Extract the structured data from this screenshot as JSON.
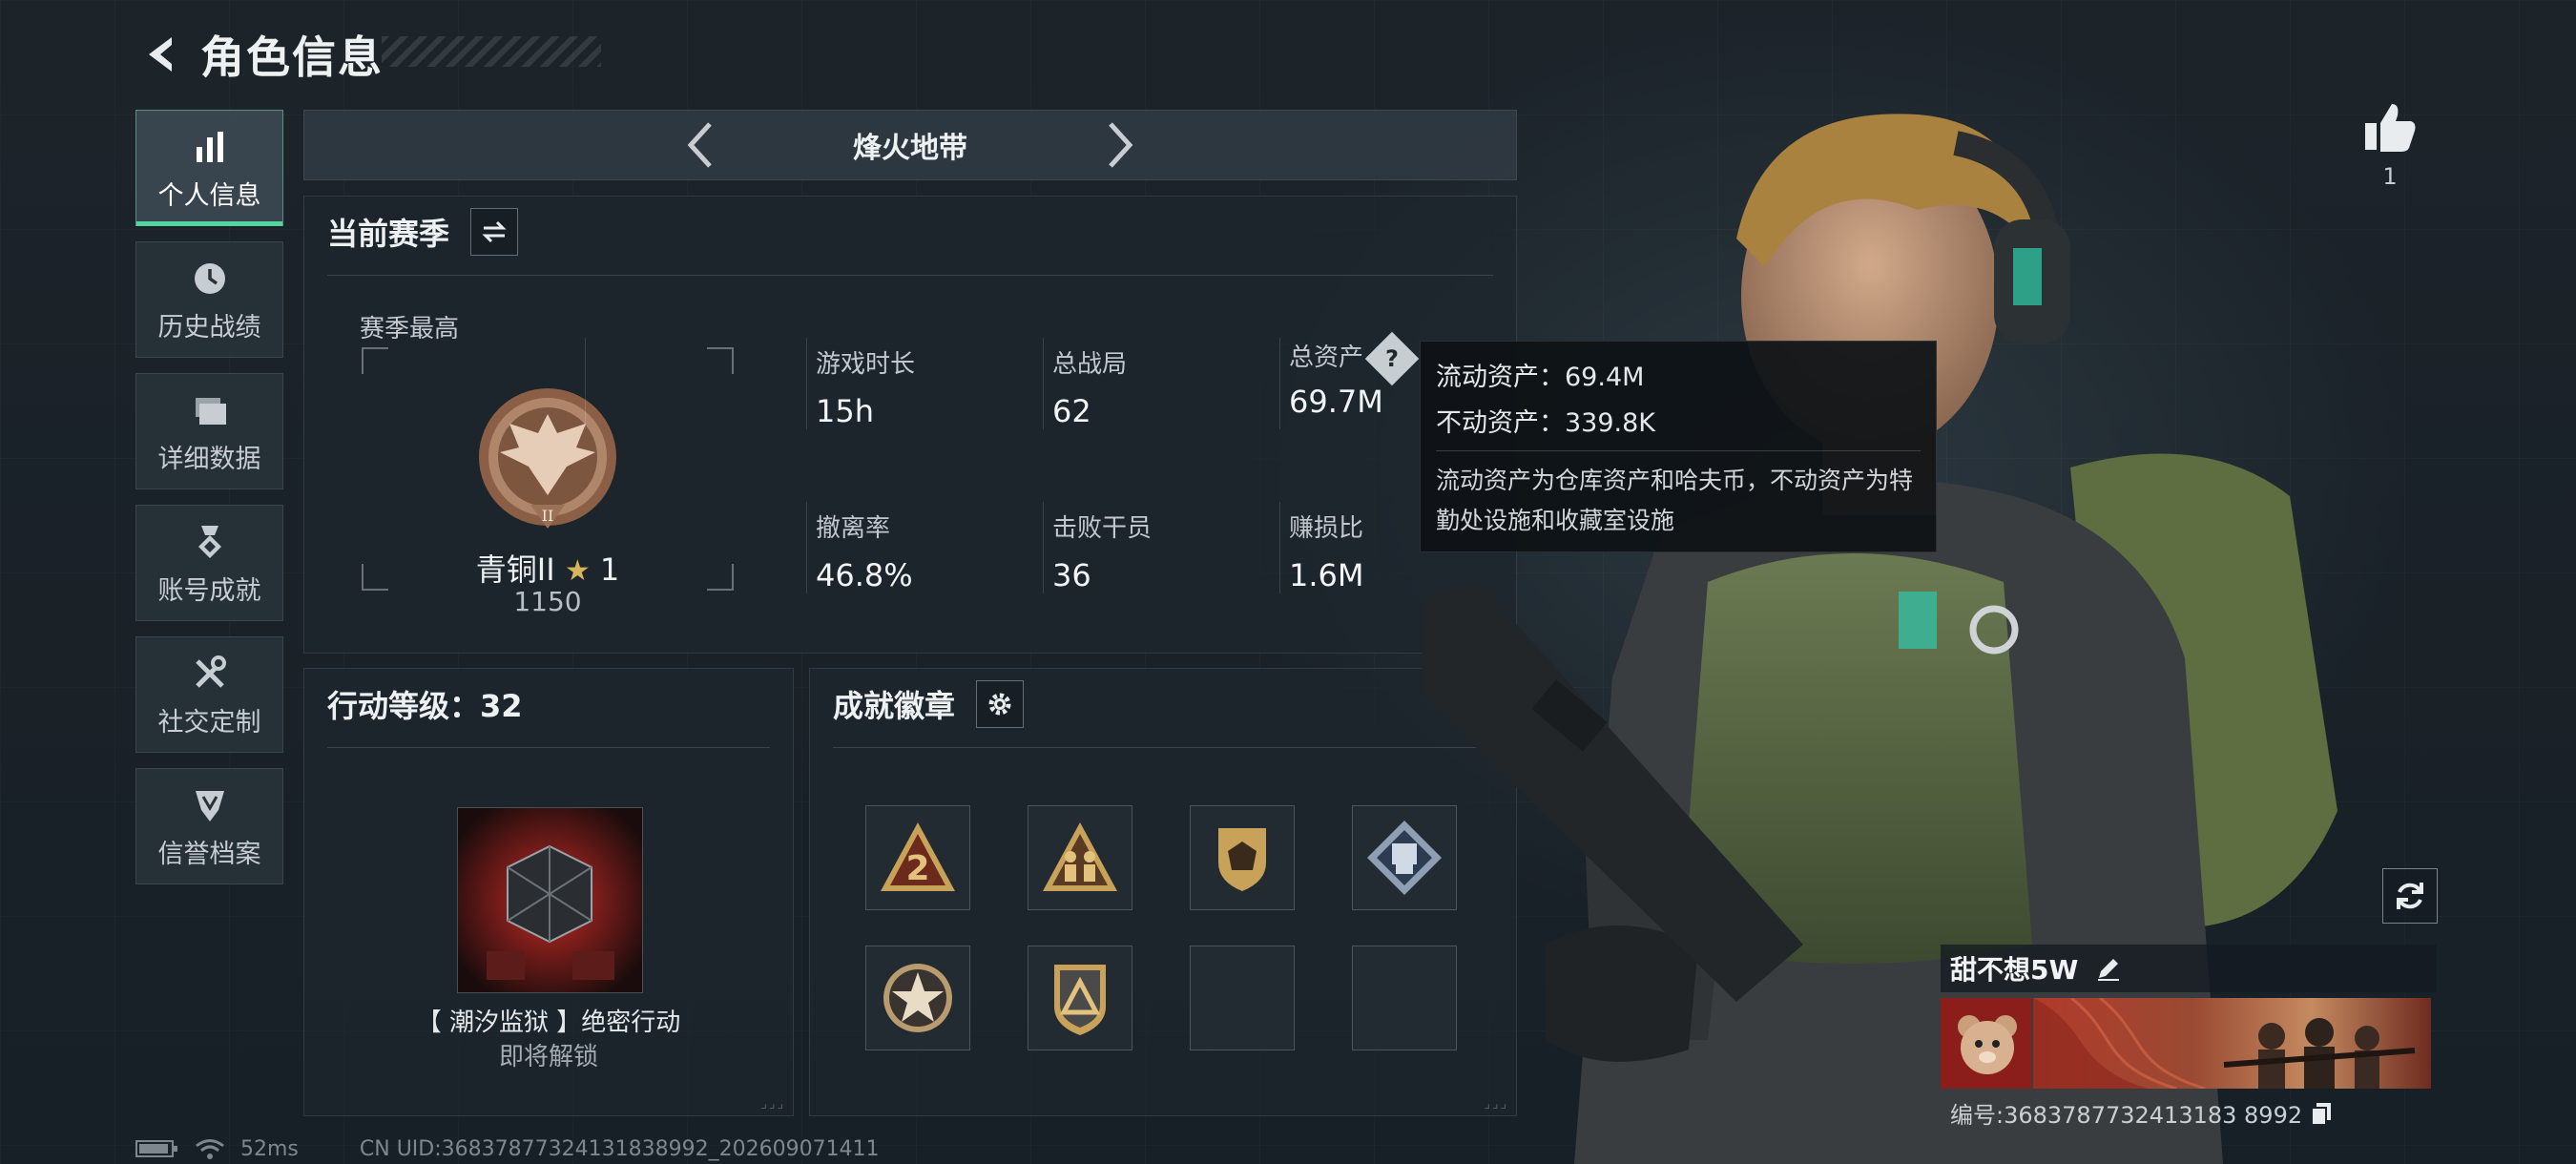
{
  "header": {
    "title": "角色信息"
  },
  "sidebar": {
    "items": [
      {
        "label": "个人信息",
        "active": true
      },
      {
        "label": "历史战绩",
        "active": false
      },
      {
        "label": "详细数据",
        "active": false
      },
      {
        "label": "账号成就",
        "active": false
      },
      {
        "label": "社交定制",
        "active": false
      },
      {
        "label": "信誉档案",
        "active": false
      }
    ]
  },
  "mode": {
    "title": "烽火地带"
  },
  "season": {
    "title": "当前赛季",
    "best_label": "赛季最高",
    "rank_name": "青铜II",
    "rank_stars": "1",
    "rank_score": "1150",
    "stats": [
      {
        "label": "游戏时长",
        "value": "15h"
      },
      {
        "label": "总战局",
        "value": "62"
      },
      {
        "label": "总资产",
        "value": "69.7M"
      },
      {
        "label": "撤离率",
        "value": "46.8%"
      },
      {
        "label": "击败干员",
        "value": "36"
      },
      {
        "label": "赚损比",
        "value": "1.6M"
      }
    ]
  },
  "tooltip": {
    "liquid": "流动资产：69.4M",
    "fixed": "不动资产：339.8K",
    "description": "流动资产为仓库资产和哈夫币，不动资产为特勤处设施和收藏室设施"
  },
  "level": {
    "title": "行动等级：32",
    "item_name": "【 潮汐监狱 】绝密行动",
    "item_status": "即将解锁"
  },
  "badges": {
    "title": "成就徽章",
    "slots": [
      {
        "icon": "number-2-triangle-badge-icon",
        "empty": false
      },
      {
        "icon": "soldiers-triangle-badge-icon",
        "empty": false
      },
      {
        "icon": "dice-shield-badge-icon",
        "empty": false
      },
      {
        "icon": "device-diamond-badge-icon",
        "empty": false
      },
      {
        "icon": "star-gear-badge-icon",
        "empty": false
      },
      {
        "icon": "triangle-shield-badge-icon",
        "empty": false
      },
      {
        "icon": "",
        "empty": true
      },
      {
        "icon": "",
        "empty": true
      }
    ]
  },
  "likes": {
    "count": "1"
  },
  "player": {
    "name": "甜不想5W",
    "id_text": "编号:3683787732413183 8992"
  },
  "status": {
    "ping": "52ms",
    "uid": "CN UID:36837877324131838992_202609071411"
  },
  "colors": {
    "accent": "#52d6a0",
    "panel_bg": "#1e262d",
    "badge_gold": "#c9a25a",
    "rank_bronze": "#a27658"
  }
}
